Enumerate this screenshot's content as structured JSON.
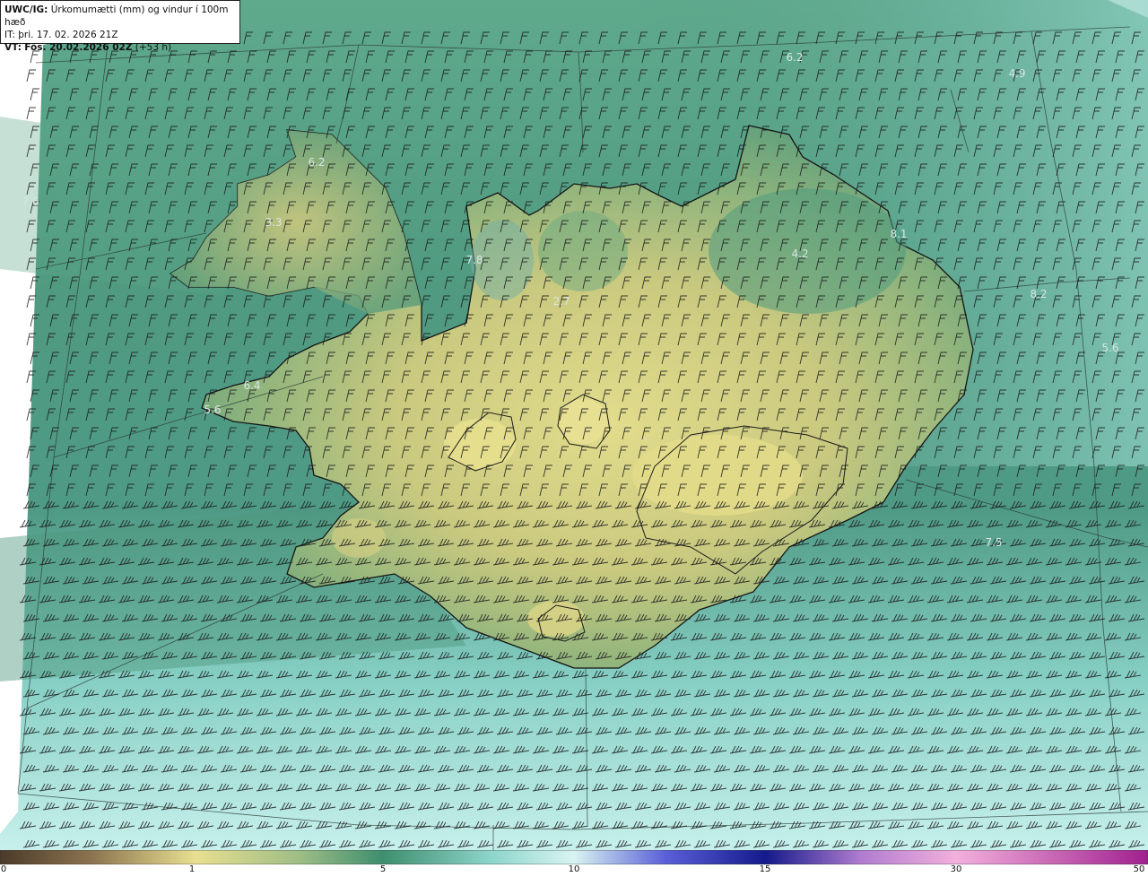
{
  "header": {
    "model": "UWC/IG:",
    "title": "Úrkomumætti (mm) og vindur í 100m hæð",
    "init_prefix": "IT:",
    "init_time": "þri. 17. 02. 2026 21Z",
    "valid_prefix": "VT:",
    "valid_time": "Fös. 20.02.2026 02Z",
    "lead": "(+53 h)"
  },
  "map_values": [
    {
      "label": "6.2"
    },
    {
      "label": "3.3"
    },
    {
      "label": "7.6"
    },
    {
      "label": "7.8"
    },
    {
      "label": "2.7"
    },
    {
      "label": "6.4"
    },
    {
      "label": "5.6"
    },
    {
      "label": "4.2"
    },
    {
      "label": "8.2"
    },
    {
      "label": "4.9"
    },
    {
      "label": "5.6"
    },
    {
      "label": "7.5"
    },
    {
      "label": "8.1"
    },
    {
      "label": "6.2"
    }
  ],
  "colorbar": {
    "ticks": [
      "0",
      "1",
      "5",
      "10",
      "15",
      "30",
      "50"
    ],
    "colors": [
      "#4b3a2a",
      "#b89a62",
      "#e6dc88",
      "#9fbe86",
      "#3e8e6e",
      "#8fd6cc",
      "#d6f3f0",
      "#5a5fd8",
      "#141a8a",
      "#c27bcf",
      "#f2a8d9",
      "#a0208e"
    ]
  },
  "colors": {
    "land_low": "#e3dd8f",
    "land_mid": "#9dbb82",
    "sea_dark": "#3f8a70",
    "sea_light": "#b6e7e4",
    "coast": "#1a1a1a"
  }
}
